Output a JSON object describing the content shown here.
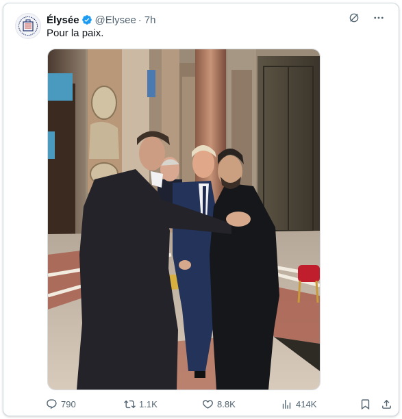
{
  "tweet": {
    "author_name": "Élysée",
    "author_handle": "@Elysee",
    "separator": "·",
    "timestamp": "7h",
    "text": "Pour la paix.",
    "photo_alt_icon": "photo-of-four-men-in-basilica"
  },
  "actions": {
    "replies": "790",
    "reposts": "1.1K",
    "likes": "8.8K",
    "views": "414K"
  },
  "colors": {
    "text_primary": "#0f1419",
    "text_secondary": "#536471",
    "verified": "#1d9bf0",
    "border": "#cfd9de"
  },
  "icons": {
    "avatar": "elysee-seal-icon",
    "verified": "verified-badge-icon",
    "grok": "grok-icon",
    "more": "more-dots-icon",
    "reply": "reply-icon",
    "repost": "repost-icon",
    "like": "heart-icon",
    "views": "views-chart-icon",
    "bookmark": "bookmark-icon",
    "share": "share-icon"
  }
}
